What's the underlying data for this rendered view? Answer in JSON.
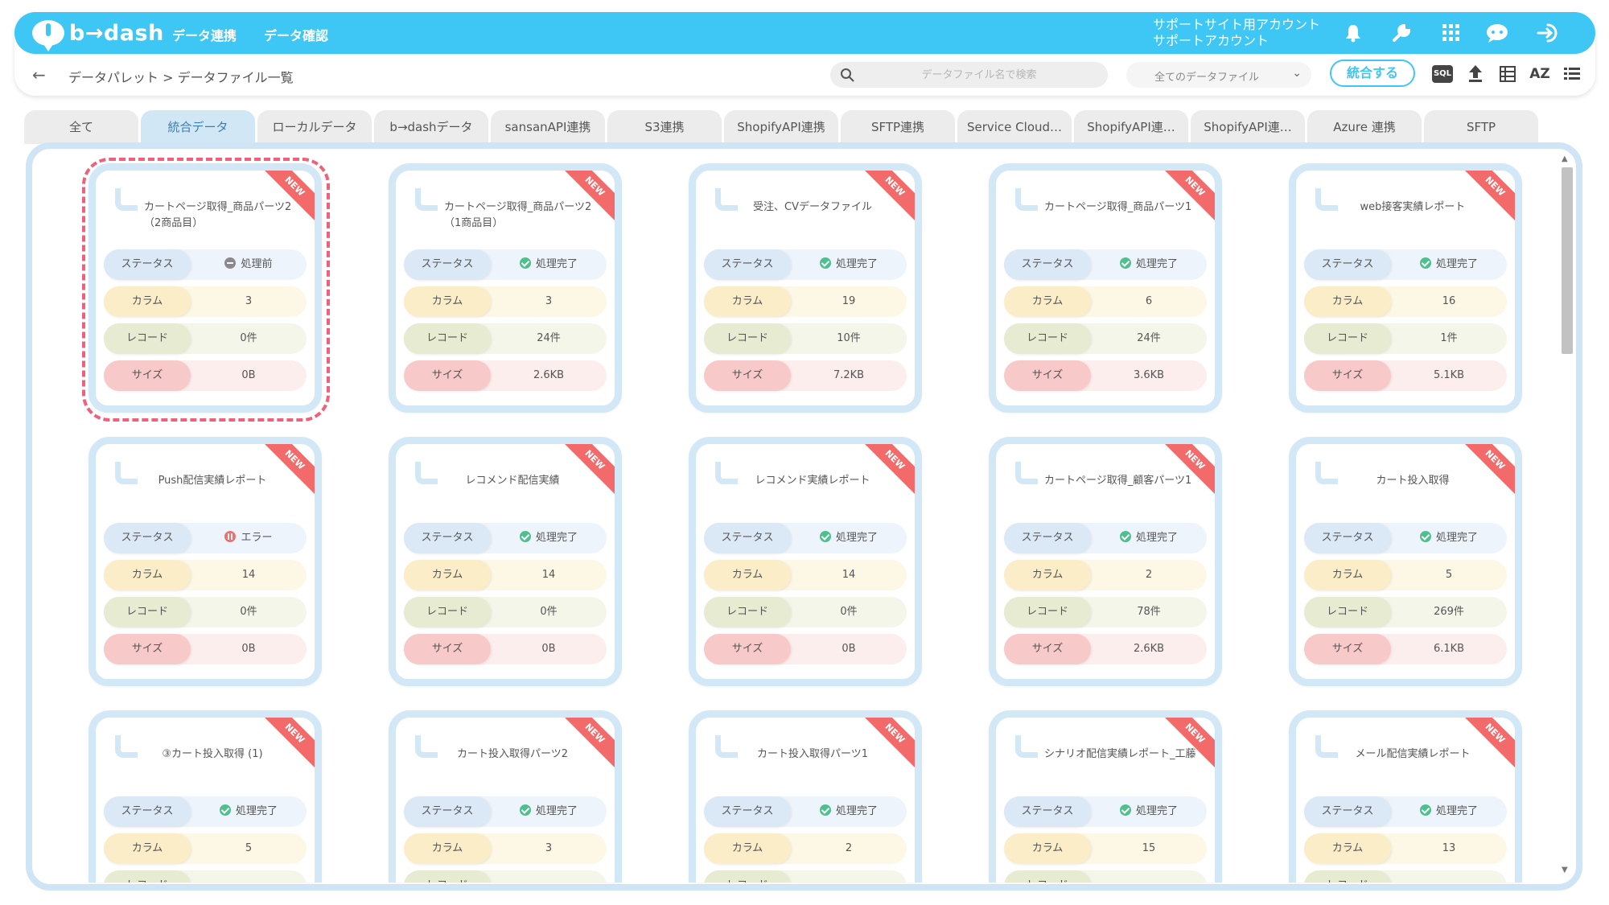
{
  "app": {
    "logo_text": "b→dash"
  },
  "nav": {
    "items": [
      "データ連携",
      "データ確認"
    ]
  },
  "account": {
    "line1": "サポートサイト用アカウント",
    "line2": "サポートアカウント"
  },
  "breadcrumb": {
    "text": "データパレット > データファイル一覧"
  },
  "search": {
    "placeholder": "データファイル名で検索"
  },
  "filter": {
    "selected": "全てのデータファイル"
  },
  "toolbar": {
    "merge_label": "統合する",
    "sql_label": "SQL",
    "az_label": "AZ"
  },
  "tabs": [
    {
      "label": "全て"
    },
    {
      "label": "統合データ"
    },
    {
      "label": "ローカルデータ"
    },
    {
      "label": "b→dashデータ"
    },
    {
      "label": "sansanAPI連携"
    },
    {
      "label": "S3連携"
    },
    {
      "label": "ShopifyAPI連携"
    },
    {
      "label": "SFTP連携"
    },
    {
      "label": "Service Cloud…"
    },
    {
      "label": "ShopifyAPI連…"
    },
    {
      "label": "ShopifyAPI連…"
    },
    {
      "label": "Azure 連携"
    },
    {
      "label": "SFTP"
    }
  ],
  "labels": {
    "status": "ステータス",
    "column": "カラム",
    "record": "レコード",
    "size": "サイズ",
    "new": "NEW"
  },
  "cards": [
    {
      "title": "カートページ取得_商品パーツ2（2商品目）",
      "status": "処理前",
      "status_type": "pre",
      "columns": "3",
      "records": "0件",
      "size": "0B"
    },
    {
      "title": "カートページ取得_商品パーツ2（1商品目）",
      "status": "処理完了",
      "status_type": "done",
      "columns": "3",
      "records": "24件",
      "size": "2.6KB"
    },
    {
      "title": "受注、CVデータファイル",
      "status": "処理完了",
      "status_type": "done",
      "columns": "19",
      "records": "10件",
      "size": "7.2KB"
    },
    {
      "title": "カートページ取得_商品パーツ1",
      "status": "処理完了",
      "status_type": "done",
      "columns": "6",
      "records": "24件",
      "size": "3.6KB"
    },
    {
      "title": "web接客実績レポート",
      "status": "処理完了",
      "status_type": "done",
      "columns": "16",
      "records": "1件",
      "size": "5.1KB"
    },
    {
      "title": "Push配信実績レポート",
      "status": "エラー",
      "status_type": "err",
      "columns": "14",
      "records": "0件",
      "size": "0B"
    },
    {
      "title": "レコメンド配信実績",
      "status": "処理完了",
      "status_type": "done",
      "columns": "14",
      "records": "0件",
      "size": "0B"
    },
    {
      "title": "レコメンド実績レポート",
      "status": "処理完了",
      "status_type": "done",
      "columns": "14",
      "records": "0件",
      "size": "0B"
    },
    {
      "title": "カートページ取得_顧客パーツ1",
      "status": "処理完了",
      "status_type": "done",
      "columns": "2",
      "records": "78件",
      "size": "2.6KB"
    },
    {
      "title": "カート投入取得",
      "status": "処理完了",
      "status_type": "done",
      "columns": "5",
      "records": "269件",
      "size": "6.1KB"
    },
    {
      "title": "③カート投入取得 (1)",
      "status": "処理完了",
      "status_type": "done",
      "columns": "5",
      "records": "",
      "size": ""
    },
    {
      "title": "カート投入取得パーツ2",
      "status": "処理完了",
      "status_type": "done",
      "columns": "3",
      "records": "",
      "size": ""
    },
    {
      "title": "カート投入取得パーツ1",
      "status": "処理完了",
      "status_type": "done",
      "columns": "2",
      "records": "",
      "size": ""
    },
    {
      "title": "シナリオ配信実績レポート_工藤",
      "status": "処理完了",
      "status_type": "done",
      "columns": "15",
      "records": "",
      "size": ""
    },
    {
      "title": "メール配信実績レポート",
      "status": "処理完了",
      "status_type": "done",
      "columns": "13",
      "records": "",
      "size": ""
    }
  ],
  "colors": {
    "accent": "#3ec6f5",
    "new_ribbon": "#f26a6a",
    "done": "#4fc08d",
    "error": "#f07070",
    "selected_outline": "#f0607a"
  }
}
